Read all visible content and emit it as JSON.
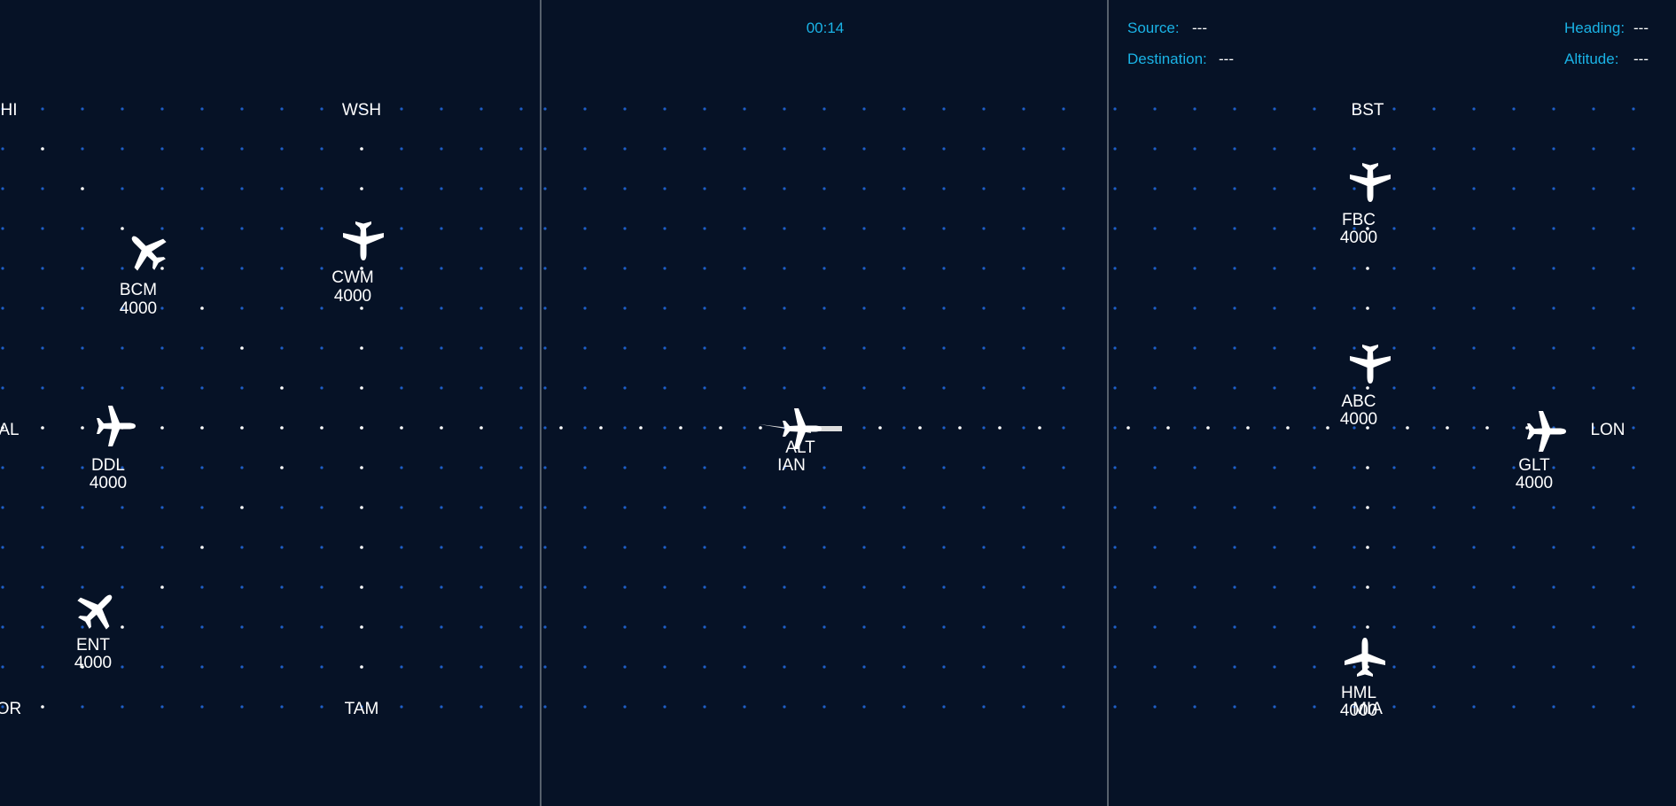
{
  "timer": "00:14",
  "info": {
    "source_label": "Source:",
    "source_value": "---",
    "destination_label": "Destination:",
    "destination_value": "---",
    "heading_label": "Heading:",
    "heading_value": "---",
    "altitude_label": "Altitude:",
    "altitude_value": "---"
  },
  "waypoints": {
    "hi": "HI",
    "wsh": "WSH",
    "al": "AL",
    "or": "OR",
    "tam": "TAM",
    "bst": "BST",
    "lon": "LON",
    "ian": "IAN",
    "mia": "MIA"
  },
  "aircraft": {
    "bcm": {
      "callsign": "BCM",
      "altitude": "4000"
    },
    "cwm": {
      "callsign": "CWM",
      "altitude": "4000"
    },
    "ddl": {
      "callsign": "DDL",
      "altitude": "4000"
    },
    "ent": {
      "callsign": "ENT",
      "altitude": "4000"
    },
    "alt": {
      "callsign": "ALT",
      "altitude": ""
    },
    "fbc": {
      "callsign": "FBC",
      "altitude": "4000"
    },
    "abc": {
      "callsign": "ABC",
      "altitude": "4000"
    },
    "glt": {
      "callsign": "GLT",
      "altitude": "4000"
    },
    "hml": {
      "callsign": "HML",
      "altitude": "4000"
    }
  },
  "colors": {
    "background": "#061226",
    "grid_dot": "#1f5fc8",
    "route_dot": "#ffffff",
    "accent": "#1ab3e6",
    "divider": "#56606c"
  }
}
